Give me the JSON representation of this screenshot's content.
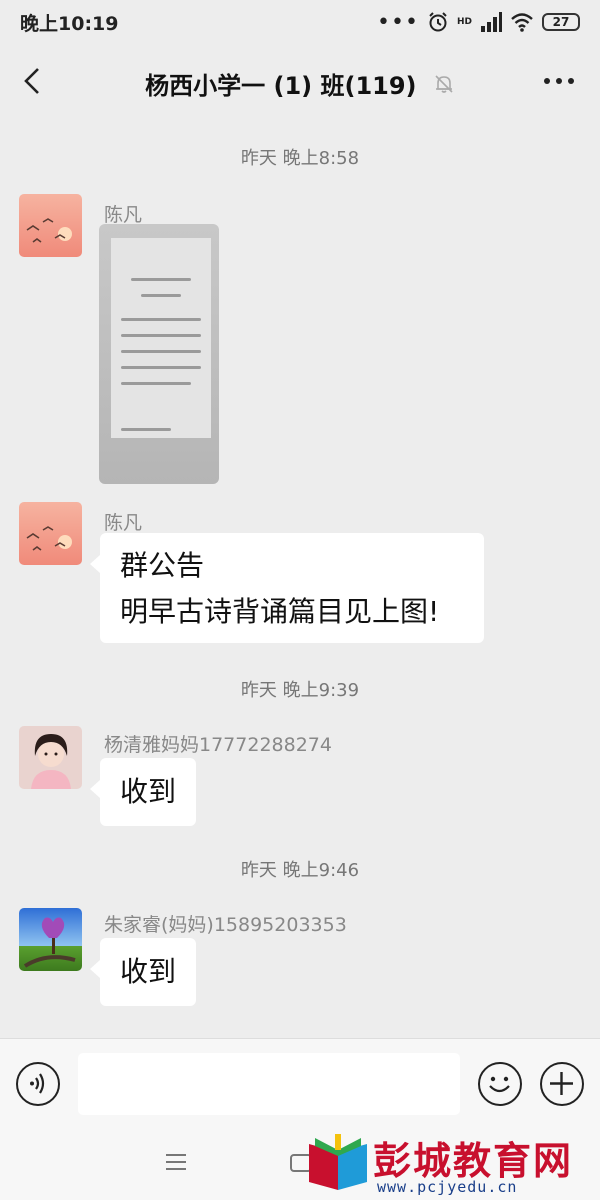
{
  "status_bar": {
    "time": "晚上10:19",
    "battery": "27",
    "network_label": "HD"
  },
  "header": {
    "title": "杨西小学一 (1) 班(119)"
  },
  "messages": [
    {
      "time": "昨天 晚上8:58",
      "sender": "陈凡",
      "type": "image"
    },
    {
      "sender": "陈凡",
      "type": "text",
      "lines": [
        "群公告",
        "明早古诗背诵篇目见上图!"
      ]
    },
    {
      "time": "昨天 晚上9:39",
      "sender": "杨清雅妈妈17772288274",
      "type": "text",
      "lines": [
        "收到"
      ]
    },
    {
      "time": "昨天 晚上9:46",
      "sender": "朱家睿(妈妈)15895203353",
      "type": "text",
      "lines": [
        "收到"
      ]
    }
  ],
  "input": {
    "placeholder": ""
  },
  "watermark": {
    "title": "彭城教育网",
    "url": "www.pcjyedu.cn"
  },
  "colors": {
    "background": "#ededed",
    "bubble": "#ffffff",
    "watermark_red": "#c8102e",
    "watermark_blue": "#1a3f8a"
  }
}
